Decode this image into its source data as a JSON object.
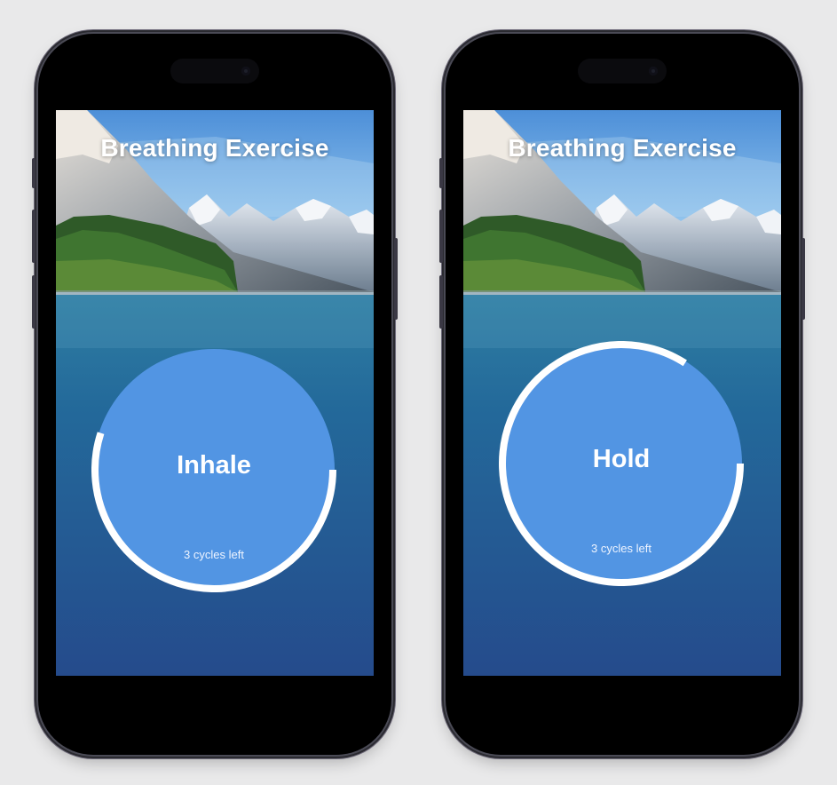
{
  "colors": {
    "background": "#e9e9ea",
    "circle_fill": "#5295e3",
    "ring_stroke": "#ffffff",
    "water_top": "#2f7ea3",
    "water_bottom": "#254b8c"
  },
  "screens": [
    {
      "title": "Breathing Exercise",
      "phase": "Inhale",
      "cycles_text": "3 cycles left",
      "ring_progress": 0.55
    },
    {
      "title": "Breathing Exercise",
      "phase": "Hold",
      "cycles_text": "3 cycles left",
      "ring_progress": 0.84
    }
  ]
}
